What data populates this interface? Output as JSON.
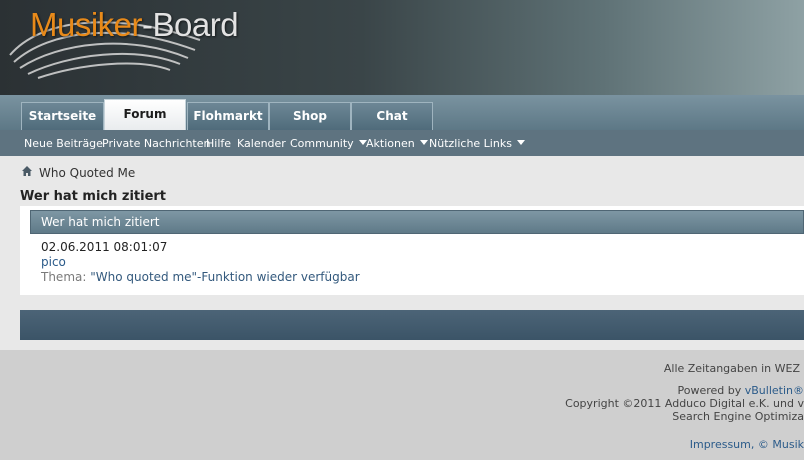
{
  "logo": {
    "part1": "Musiker",
    "part2": "-Board"
  },
  "tabs": [
    {
      "label": "Startseite",
      "active": false
    },
    {
      "label": "Forum",
      "active": true
    },
    {
      "label": "Flohmarkt",
      "active": false
    },
    {
      "label": "Shop",
      "active": false
    },
    {
      "label": "Chat",
      "active": false
    }
  ],
  "subnav": [
    {
      "label": "Neue Beiträge",
      "dropdown": false
    },
    {
      "label": "Private Nachrichten",
      "dropdown": false
    },
    {
      "label": "Hilfe",
      "dropdown": false
    },
    {
      "label": "Kalender",
      "dropdown": false
    },
    {
      "label": "Community",
      "dropdown": true
    },
    {
      "label": "Aktionen",
      "dropdown": true
    },
    {
      "label": "Nützliche Links",
      "dropdown": true
    }
  ],
  "breadcrumb": {
    "home_icon": "home-icon",
    "current": "Who Quoted Me"
  },
  "page_title": "Wer hat mich zitiert",
  "panel": {
    "header": "Wer hat mich zitiert",
    "entry": {
      "date": "02.06.2011 08:01:07",
      "user": "pico",
      "thread_label": "Thema:",
      "thread_title": "\"Who quoted me\"-Funktion wieder verfügbar"
    }
  },
  "footer": {
    "timezone": "Alle Zeitangaben in WEZ",
    "powered_prefix": "Powered by",
    "powered_link": "vBulletin®",
    "copyright": "Copyright ©2011 Adduco Digital e.K. und v",
    "seo": "Search Engine Optimiza",
    "link_impressum": "Impressum",
    "link_sep": ", ©",
    "link_musiker": "Musik"
  },
  "colors": {
    "accent_orange": "#e88a1a",
    "tab_blue": "#5d7886",
    "subnav": "#5e7380",
    "link": "#2b5b8a",
    "footer_bar": "#3b5467"
  }
}
